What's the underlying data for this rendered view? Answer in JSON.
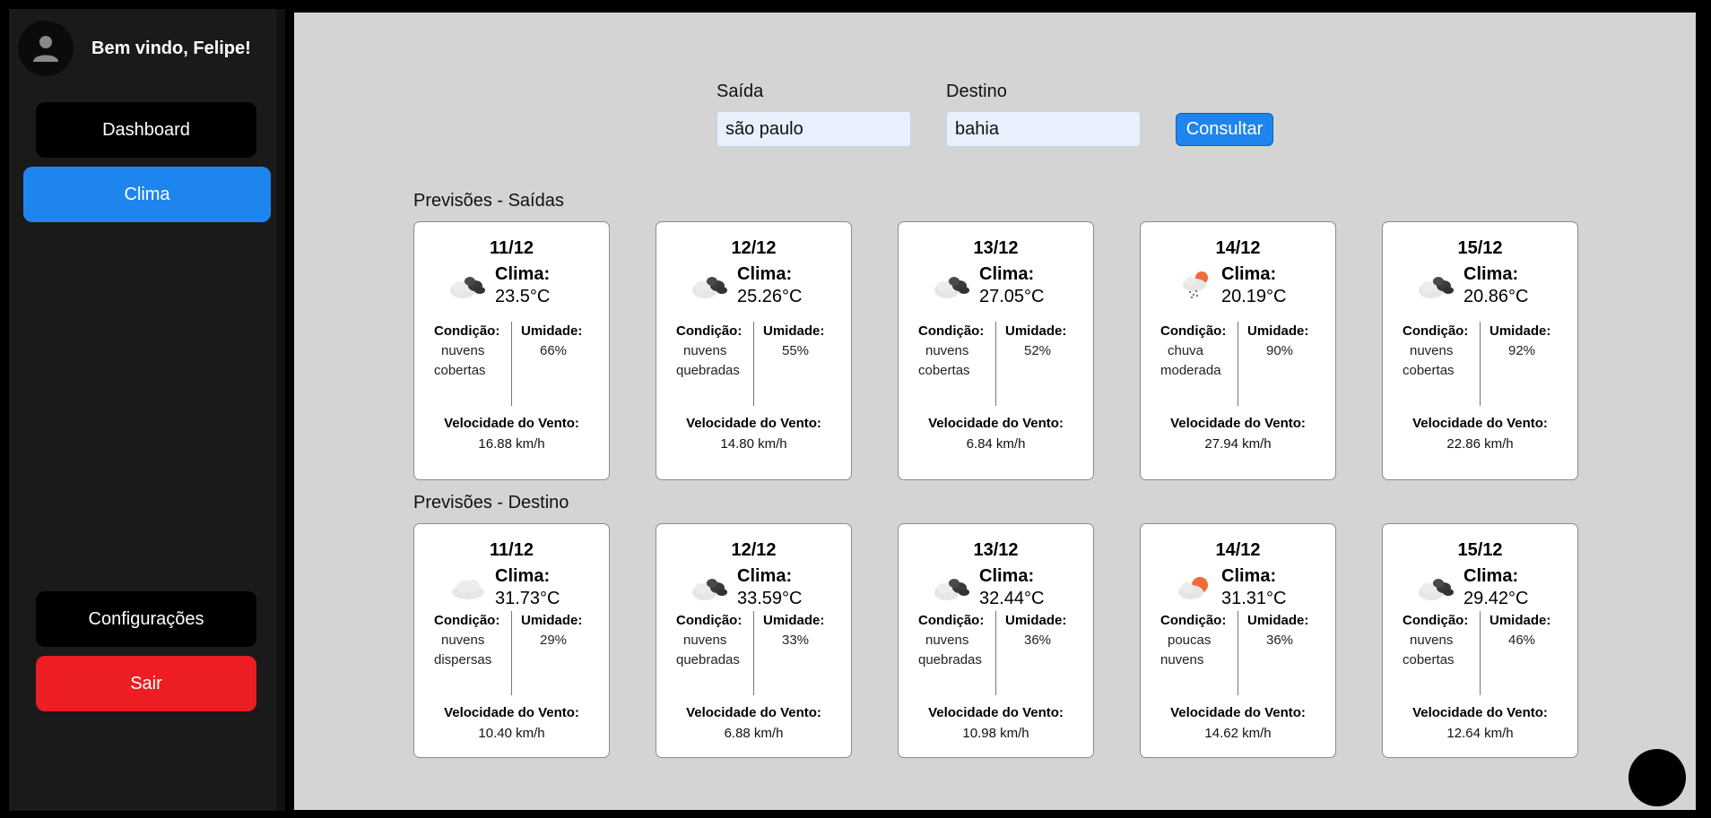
{
  "user": {
    "welcome": "Bem vindo, Felipe!"
  },
  "nav": {
    "dashboard": "Dashboard",
    "clima": "Clima",
    "config": "Configurações",
    "sair": "Sair"
  },
  "form": {
    "saida_label": "Saída",
    "saida_value": "são paulo",
    "destino_label": "Destino",
    "destino_value": "bahia",
    "button": "Consultar"
  },
  "labels": {
    "clima": "Clima:",
    "condicao": "Condição:",
    "umidade": "Umidade:",
    "vento": "Velocidade do Vento:"
  },
  "sections": {
    "saidas_title": "Previsões - Saídas",
    "destino_title": "Previsões - Destino"
  },
  "saidas": [
    {
      "date": "11/12",
      "icon": "broken-clouds-icon",
      "temp": "23.5°C",
      "cond1": "nuvens",
      "cond2": "cobertas",
      "umidade": "66%",
      "vento": "16.88 km/h"
    },
    {
      "date": "12/12",
      "icon": "broken-clouds-icon",
      "temp": "25.26°C",
      "cond1": "nuvens",
      "cond2": "quebradas",
      "umidade": "55%",
      "vento": "14.80 km/h"
    },
    {
      "date": "13/12",
      "icon": "broken-clouds-icon",
      "temp": "27.05°C",
      "cond1": "nuvens",
      "cond2": "cobertas",
      "umidade": "52%",
      "vento": "6.84 km/h"
    },
    {
      "date": "14/12",
      "icon": "rain-sun-icon",
      "temp": "20.19°C",
      "cond1": "chuva",
      "cond2": "moderada",
      "umidade": "90%",
      "vento": "27.94 km/h"
    },
    {
      "date": "15/12",
      "icon": "broken-clouds-icon",
      "temp": "20.86°C",
      "cond1": "nuvens",
      "cond2": "cobertas",
      "umidade": "92%",
      "vento": "22.86 km/h"
    }
  ],
  "destino": [
    {
      "date": "11/12",
      "icon": "scattered-clouds-icon",
      "temp": "31.73°C",
      "cond1": "nuvens",
      "cond2": "dispersas",
      "umidade": "29%",
      "vento": "10.40 km/h"
    },
    {
      "date": "12/12",
      "icon": "broken-clouds-icon",
      "temp": "33.59°C",
      "cond1": "nuvens",
      "cond2": "quebradas",
      "umidade": "33%",
      "vento": "6.88 km/h"
    },
    {
      "date": "13/12",
      "icon": "broken-clouds-icon",
      "temp": "32.44°C",
      "cond1": "nuvens",
      "cond2": "quebradas",
      "umidade": "36%",
      "vento": "10.98 km/h"
    },
    {
      "date": "14/12",
      "icon": "few-clouds-sun-icon",
      "temp": "31.31°C",
      "cond1": "poucas",
      "cond2": "nuvens",
      "umidade": "36%",
      "vento": "14.62 km/h"
    },
    {
      "date": "15/12",
      "icon": "broken-clouds-icon",
      "temp": "29.42°C",
      "cond1": "nuvens",
      "cond2": "cobertas",
      "umidade": "46%",
      "vento": "12.64 km/h"
    }
  ],
  "colors": {
    "accent": "#1f85ee",
    "danger": "#ec1d23",
    "sidebar": "#1a1a1a",
    "content_bg": "#d4d4d4"
  }
}
